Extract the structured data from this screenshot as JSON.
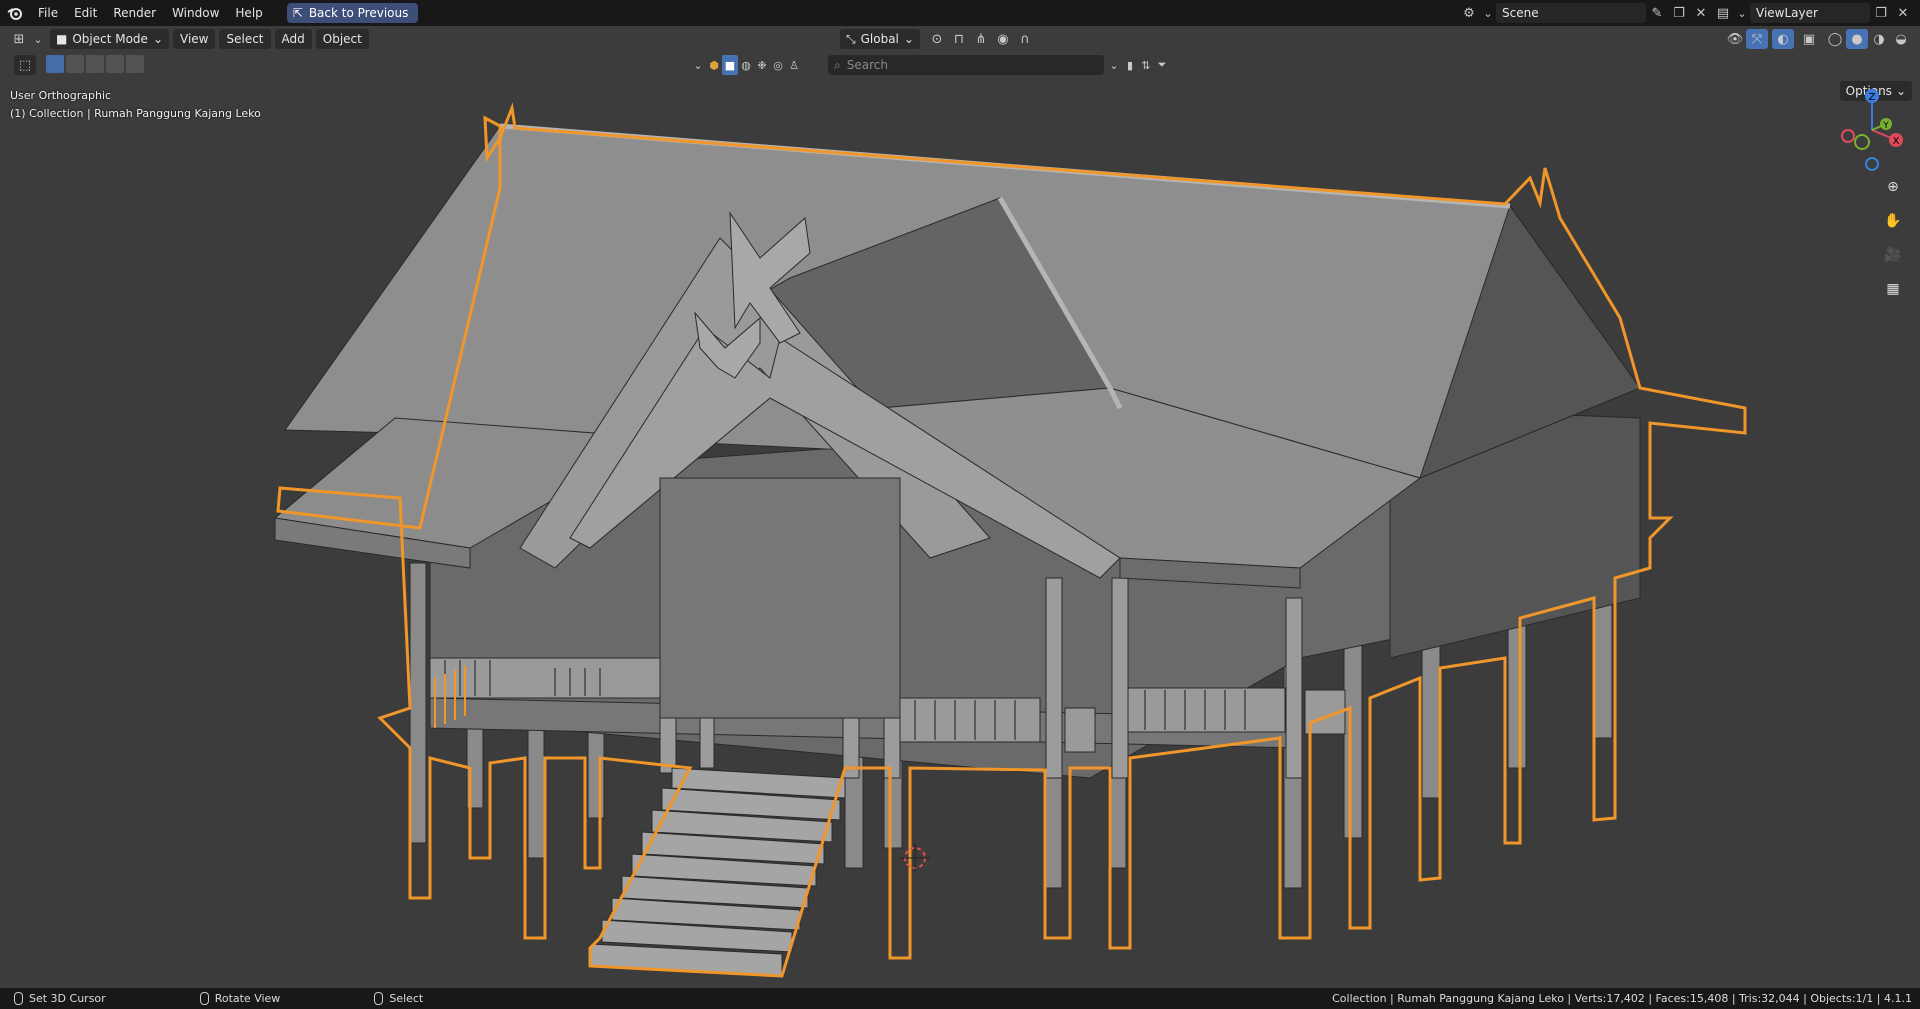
{
  "menu": {
    "items": [
      "File",
      "Edit",
      "Render",
      "Window",
      "Help"
    ],
    "back_label": "Back to Previous"
  },
  "top_right": {
    "scene": "Scene",
    "view_layer": "ViewLayer"
  },
  "header": {
    "mode": "Object Mode",
    "menus": [
      "View",
      "Select",
      "Add",
      "Object"
    ],
    "transform_orientation": "Global",
    "options_label": "Options"
  },
  "search": {
    "placeholder": "Search"
  },
  "overlay": {
    "view_name": "User Orthographic",
    "collection_line": "(1) Collection | Rumah Panggung Kajang Leko"
  },
  "gizmo": {
    "z": "Z",
    "y": "Y",
    "x": "X"
  },
  "status": {
    "left_action": "Set 3D Cursor",
    "middle_action": "Rotate View",
    "right_action": "Select",
    "stats": "Collection | Rumah Panggung Kajang Leko | Verts:17,402 | Faces:15,408 | Tris:32,044 | Objects:1/1 | 4.1.1"
  },
  "colors": {
    "selection_outline": "#f0962a",
    "background": "#3c3c3c",
    "accent": "#4772b3"
  }
}
